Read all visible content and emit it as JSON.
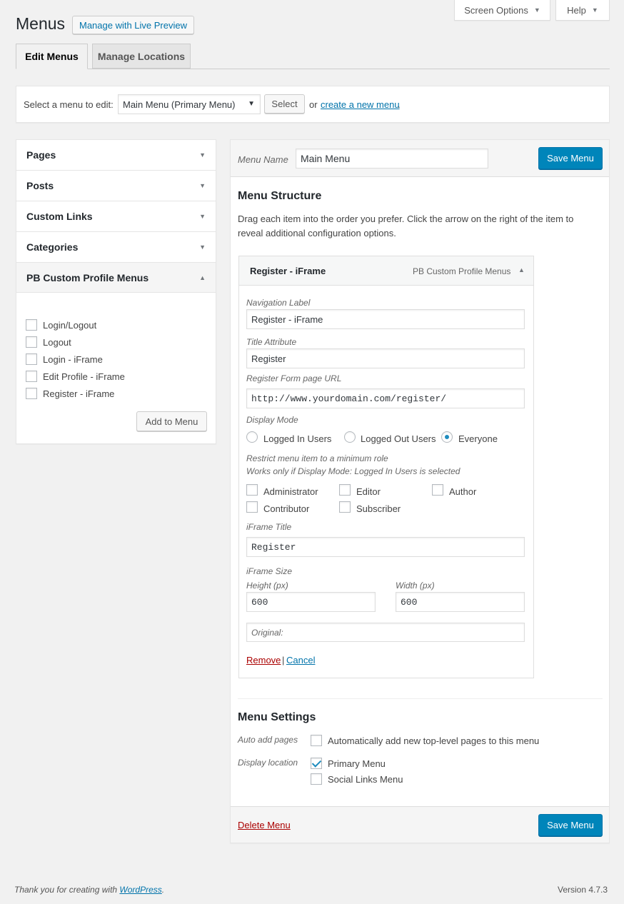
{
  "header": {
    "title": "Menus",
    "live_preview": "Manage with Live Preview",
    "screen_options": "Screen Options",
    "help": "Help"
  },
  "tabs": [
    "Edit Menus",
    "Manage Locations"
  ],
  "select_bar": {
    "label": "Select a menu to edit:",
    "selected": "Main Menu (Primary Menu)",
    "select_btn": "Select",
    "or": "or",
    "create_link": "create a new menu",
    "period": "."
  },
  "sidebar": {
    "sections": [
      "Pages",
      "Posts",
      "Custom Links",
      "Categories",
      "PB Custom Profile Menus"
    ],
    "items": [
      "Login/Logout",
      "Logout",
      "Login - iFrame",
      "Edit Profile - iFrame",
      "Register - iFrame"
    ],
    "add_btn": "Add to Menu"
  },
  "menu_header": {
    "name_label": "Menu Name",
    "name_value": "Main Menu",
    "save": "Save Menu"
  },
  "structure": {
    "title": "Menu Structure",
    "desc_line1": "Drag each item into the order you prefer. Click the arrow on the right of the item to",
    "desc_line2": "reveal additional configuration options."
  },
  "item": {
    "title": "Register - iFrame",
    "type": "PB Custom Profile Menus",
    "nav_label_label": "Navigation Label",
    "nav_label_value": "Register - iFrame",
    "title_attr_label": "Title Attribute",
    "title_attr_value": "Register",
    "url_label": "Register Form page URL",
    "url_value": "http://www.yourdomain.com/register/",
    "display_mode_label": "Display Mode",
    "display_modes": [
      "Logged In Users",
      "Logged Out Users",
      "Everyone"
    ],
    "restrict_line1": "Restrict menu item to a minimum role",
    "restrict_line2": "Works only if Display Mode: Logged In Users is selected",
    "roles": [
      "Administrator",
      "Editor",
      "Author",
      "Contributor",
      "Subscriber"
    ],
    "iframe_title_label": "iFrame Title",
    "iframe_title_value": "Register",
    "iframe_size_label": "iFrame Size",
    "height_label": "Height (px)",
    "height_value": "600",
    "width_label": "Width (px)",
    "width_value": "600",
    "original": "Original:",
    "remove": "Remove",
    "sep": "|",
    "cancel": "Cancel"
  },
  "settings": {
    "title": "Menu Settings",
    "auto_add_label": "Auto add pages",
    "auto_add_text": "Automatically add new top-level pages to this menu",
    "display_loc_label": "Display location",
    "locations": [
      "Primary Menu",
      "Social Links Menu"
    ]
  },
  "footer_bar": {
    "delete": "Delete Menu",
    "save": "Save Menu"
  },
  "page_footer": {
    "thanks": "Thank you for creating with",
    "wp_link": "WordPress",
    "period": ".",
    "version": "Version 4.7.3"
  },
  "colors": {
    "primary": "#0085ba",
    "link": "#0073aa",
    "delete": "#a00"
  }
}
